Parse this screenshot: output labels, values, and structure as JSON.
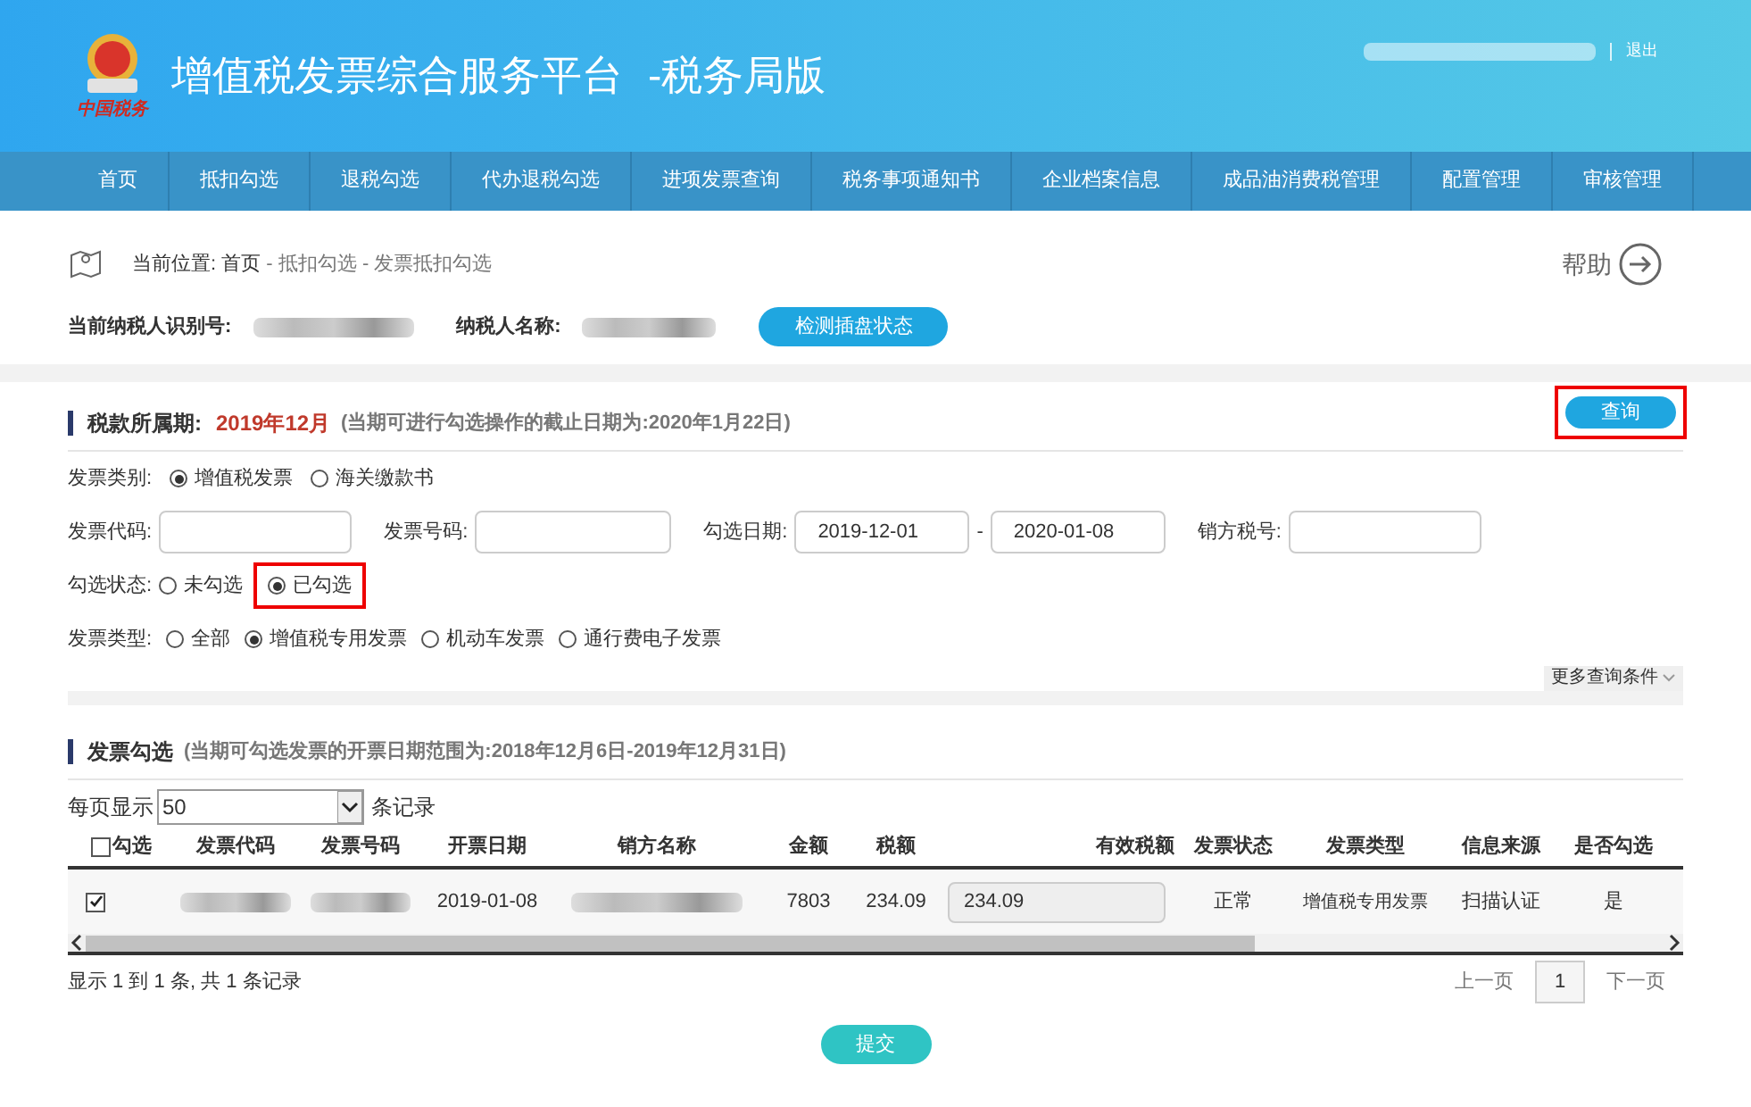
{
  "header": {
    "logo_text": "中国税务",
    "title": "增值税发票综合服务平台",
    "edition": "-税务局版",
    "logout": "退出"
  },
  "nav": [
    "首页",
    "抵扣勾选",
    "退税勾选",
    "代办退税勾选",
    "进项发票查询",
    "税务事项通知书",
    "企业档案信息",
    "成品油消费税管理",
    "配置管理",
    "审核管理"
  ],
  "breadcrumb": {
    "label": "当前位置:",
    "path": "首页",
    "rest": " - 抵扣勾选 - 发票抵扣勾选"
  },
  "help": "帮助",
  "taxpayer": {
    "id_label": "当前纳税人识别号:",
    "name_label": "纳税人名称:",
    "check_button": "检测插盘状态"
  },
  "period": {
    "label": "税款所属期:",
    "value": "2019年12月",
    "note": "(当期可进行勾选操作的截止日期为:2020年1月22日)",
    "query_button": "查询"
  },
  "filters": {
    "category": {
      "label": "发票类别:",
      "options": [
        {
          "label": "增值税发票",
          "selected": true
        },
        {
          "label": "海关缴款书",
          "selected": false
        }
      ]
    },
    "code_label": "发票代码:",
    "number_label": "发票号码:",
    "date_label": "勾选日期:",
    "date_from": "2019-12-01",
    "date_sep": "-",
    "date_to": "2020-01-08",
    "seller_label": "销方税号:",
    "status": {
      "label": "勾选状态:",
      "options": [
        {
          "label": "未勾选",
          "selected": false
        },
        {
          "label": "已勾选",
          "selected": true
        }
      ]
    },
    "type": {
      "label": "发票类型:",
      "options": [
        {
          "label": "全部",
          "selected": false
        },
        {
          "label": "增值税专用发票",
          "selected": true
        },
        {
          "label": "机动车发票",
          "selected": false
        },
        {
          "label": "通行费电子发票",
          "selected": false
        }
      ]
    },
    "more": "更多查询条件"
  },
  "selection": {
    "title": "发票勾选",
    "note": "(当期可勾选发票的开票日期范围为:2018年12月6日-2019年12月31日)",
    "per_page_label": "每页显示",
    "per_page": "50",
    "per_page_suffix": "条记录"
  },
  "table": {
    "columns": [
      "勾选",
      "发票代码",
      "发票号码",
      "开票日期",
      "销方名称",
      "金额",
      "税额",
      "有效税额",
      "发票状态",
      "发票类型",
      "信息来源",
      "是否勾选"
    ],
    "all_checked": false,
    "rows": [
      {
        "checked": true,
        "date": "2019-01-08",
        "amount": "7803",
        "tax": "234.09",
        "valid_tax": "234.09",
        "status": "正常",
        "type": "增值税专用发票",
        "source": "扫描认证",
        "selected_text": "是"
      }
    ]
  },
  "pager": {
    "summary": "显示 1 到 1 条, 共 1 条记录",
    "prev": "上一页",
    "page": "1",
    "next": "下一页"
  },
  "submit": "提交"
}
